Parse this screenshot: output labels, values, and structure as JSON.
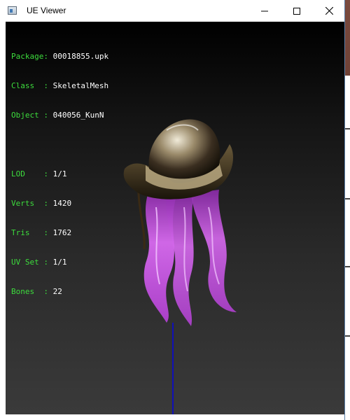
{
  "window": {
    "title": "UE Viewer",
    "icon": "ue-viewer-app-icon",
    "controls": {
      "minimize_icon": "minimize-icon",
      "maximize_icon": "maximize-icon",
      "close_icon": "close-icon"
    }
  },
  "info": {
    "package": {
      "label": "Package: ",
      "value": "00018855.upk"
    },
    "class": {
      "label": "Class  : ",
      "value": "SkeletalMesh"
    },
    "object": {
      "label": "Object : ",
      "value": "040056_KunN"
    },
    "lod": {
      "label": "LOD    : ",
      "value": "1/1"
    },
    "verts": {
      "label": "Verts  : ",
      "value": "1420"
    },
    "tris": {
      "label": "Tris   : ",
      "value": "1762"
    },
    "uvset": {
      "label": "UV Set : ",
      "value": "1/1"
    },
    "bones": {
      "label": "Bones  : ",
      "value": "22"
    }
  },
  "colors": {
    "label": "#3ddc3d",
    "value": "#ffffff",
    "axis": "#1010b8",
    "hair": "#c850e8"
  }
}
